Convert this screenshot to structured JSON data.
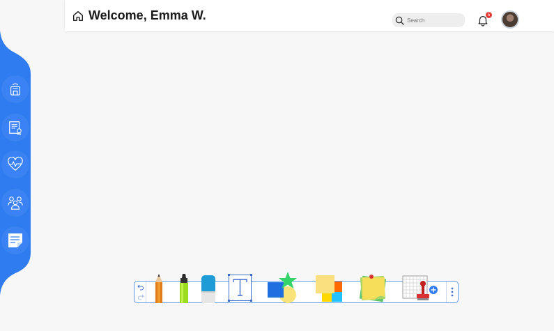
{
  "header": {
    "welcome_text": "Welcome, Emma W.",
    "search_placeholder": "Search",
    "notification_count": "5"
  },
  "sidebar": {
    "items": [
      {
        "name": "school",
        "icon": "school-icon"
      },
      {
        "name": "certificate",
        "icon": "certificate-icon"
      },
      {
        "name": "health",
        "icon": "heart-pulse-icon"
      },
      {
        "name": "group",
        "icon": "group-icon"
      },
      {
        "name": "notes",
        "icon": "notes-icon"
      }
    ]
  },
  "toolbar": {
    "tools": [
      "undo",
      "redo",
      "pencil",
      "highlighter",
      "eraser",
      "text",
      "shapes",
      "colors",
      "sticky-notes",
      "table",
      "stamp",
      "more"
    ]
  },
  "colors": {
    "accent": "#3b82f6",
    "badge": "#e53935"
  }
}
